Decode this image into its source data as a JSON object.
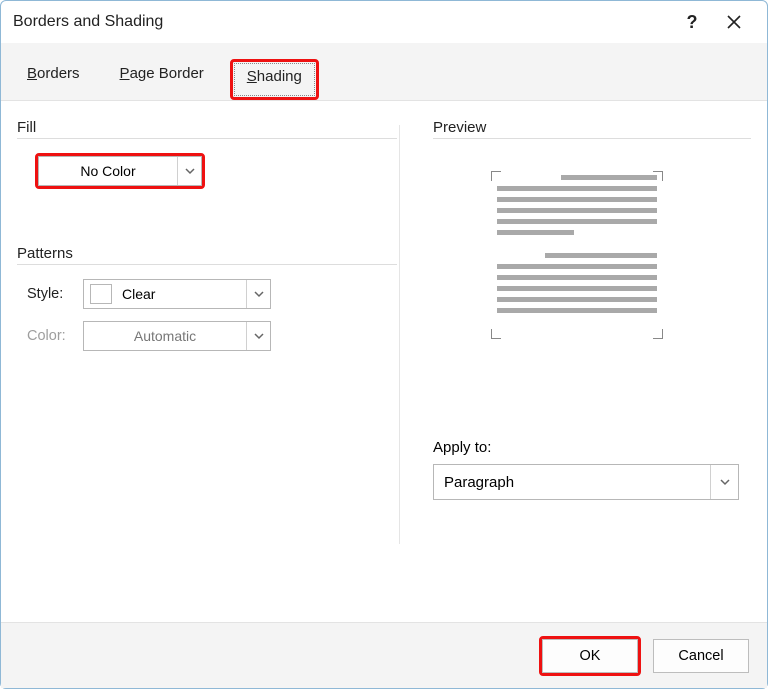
{
  "title": "Borders and Shading",
  "tabs": {
    "borders": "Borders",
    "page_border": "Page Border",
    "shading": "Shading"
  },
  "fill": {
    "label": "Fill",
    "value": "No Color"
  },
  "patterns": {
    "label": "Patterns",
    "style_label": "Style:",
    "style_value": "Clear",
    "color_label": "Color:",
    "color_value": "Automatic"
  },
  "preview": {
    "label": "Preview"
  },
  "apply_to": {
    "label": "Apply to:",
    "value": "Paragraph"
  },
  "buttons": {
    "ok": "OK",
    "cancel": "Cancel"
  }
}
